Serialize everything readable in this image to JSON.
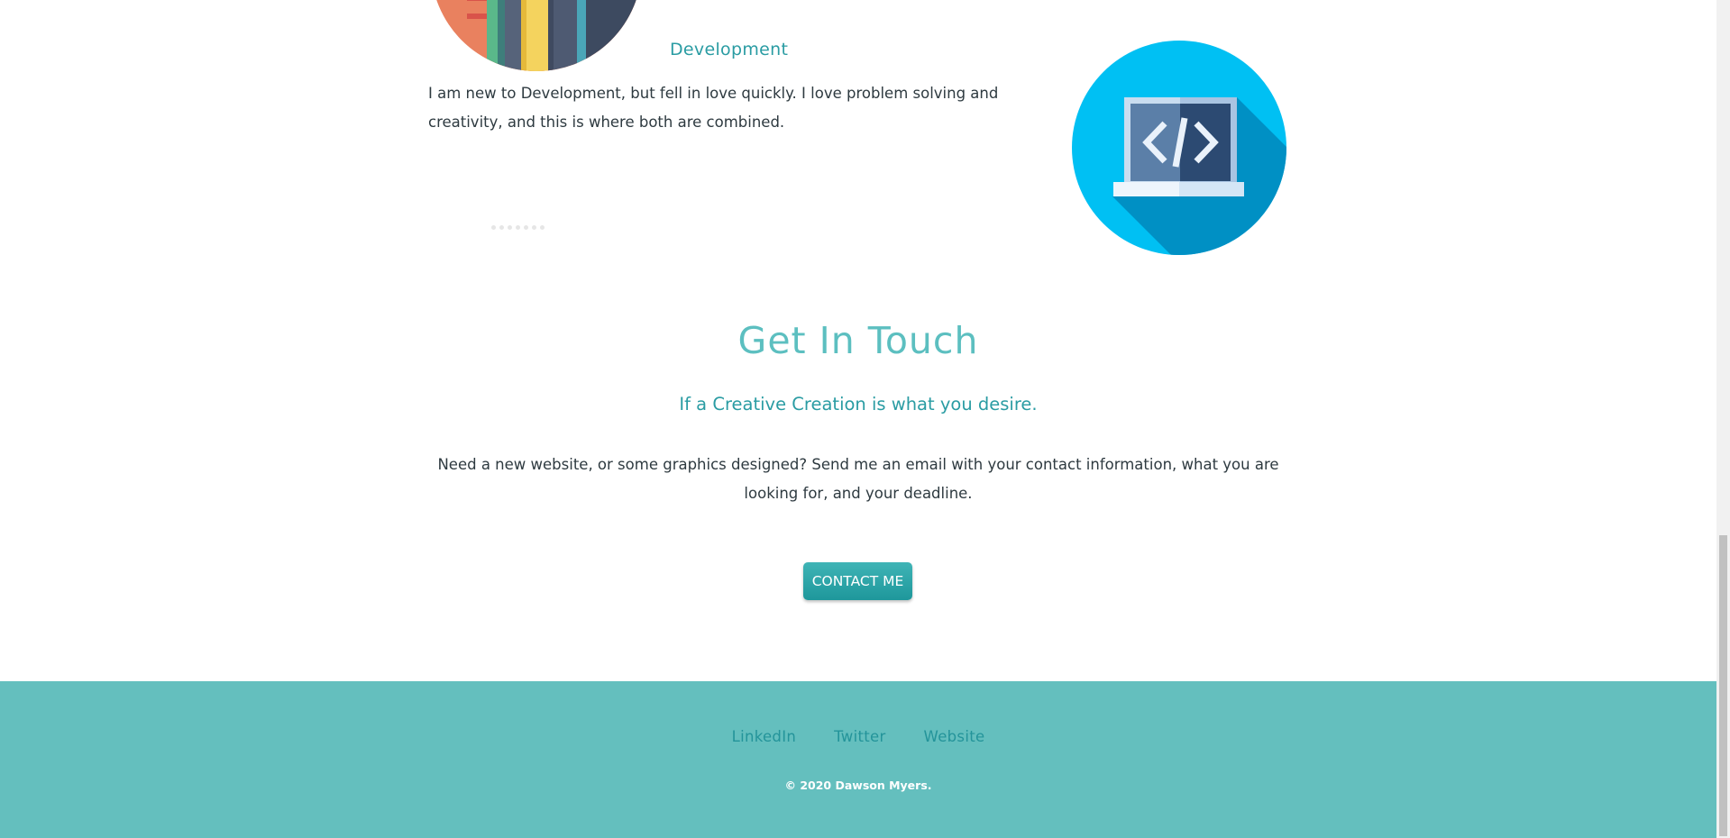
{
  "development": {
    "heading": "Development",
    "text": "I am new to Development, but fell in love quickly. I love problem solving and creativity, and this is where both are combined."
  },
  "contact_section": {
    "title": "Get In Touch",
    "subtitle": "If a Creative Creation is what you desire.",
    "text": "Need a new website, or some graphics designed? Send me an email with your contact information, what you are looking for, and your deadline.",
    "button_label": "CONTACT ME"
  },
  "footer": {
    "links": [
      {
        "label": "LinkedIn"
      },
      {
        "label": "Twitter"
      },
      {
        "label": "Website"
      }
    ],
    "copyright": "© 2020 Dawson Myers."
  },
  "colors": {
    "accent": "#2a9ca3",
    "title": "#5cbfc0",
    "footer_bg": "#64bfbe",
    "button": "#1e979b",
    "laptop_circle": "#00c0f3"
  },
  "icons": {
    "books_illustration": "books-icon",
    "laptop_code": "laptop-code-icon"
  }
}
